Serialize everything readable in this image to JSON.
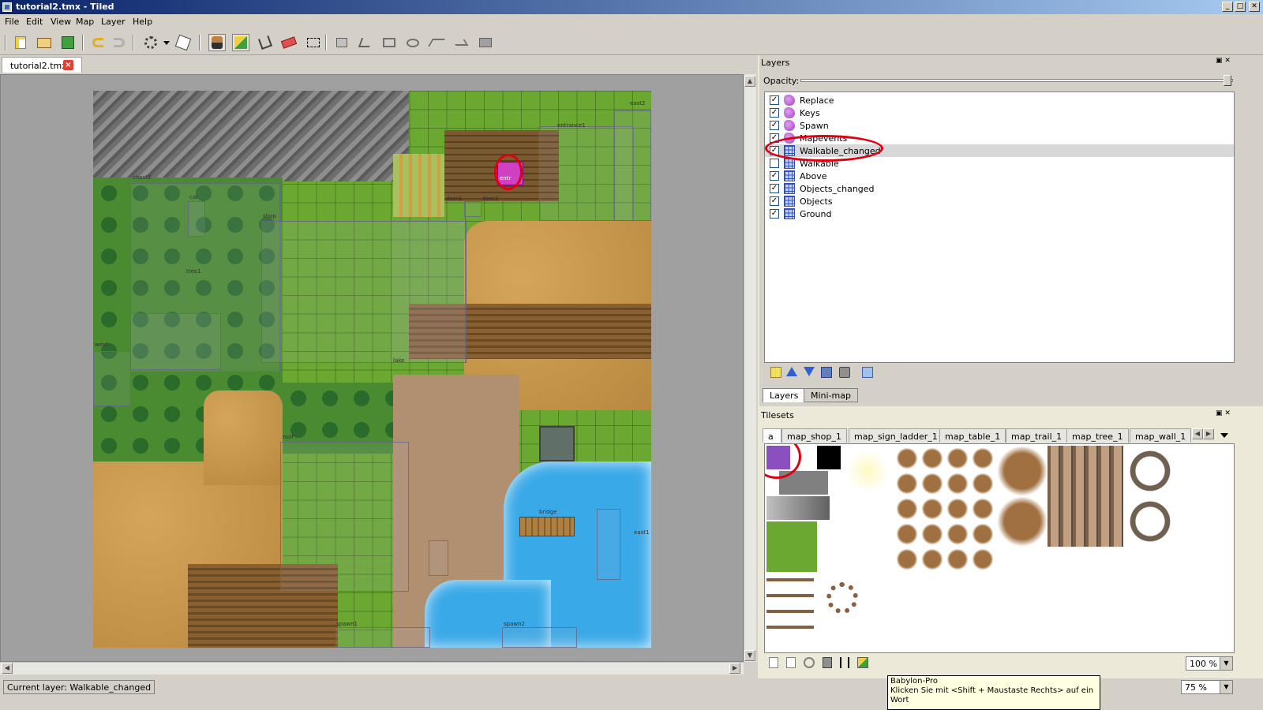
{
  "window": {
    "title": "tutorial2.tmx - Tiled",
    "minimize_glyph": "_",
    "maximize_glyph": "□",
    "close_glyph": "✕"
  },
  "menu": [
    "File",
    "Edit",
    "View",
    "Map",
    "Layer",
    "Help"
  ],
  "toolbar": {
    "icons": [
      "new-file-icon",
      "open-file-icon",
      "save-icon",
      "undo-icon",
      "redo-icon",
      "random-mode-icon",
      "dice-icon",
      "stamp-brush-icon",
      "terrain-brush-icon",
      "bucket-fill-icon",
      "eraser-icon",
      "rectangle-select-icon",
      "select-objects-icon",
      "edit-polygons-icon",
      "insert-rectangle-icon",
      "insert-ellipse-icon",
      "insert-polygon-icon",
      "insert-polyline-icon",
      "insert-tile-icon"
    ],
    "active": [
      "stamp-brush-icon",
      "terrain-brush-icon"
    ]
  },
  "document_tab": {
    "label": "tutorial2.tmx",
    "close_glyph": "×"
  },
  "map": {
    "object_labels": [
      "north",
      "east2",
      "entrance1",
      "chest2",
      "cat",
      "door1",
      "door2",
      "spawn1",
      "spawn2",
      "east1",
      "west",
      "tree1",
      "shop",
      "roof",
      "lake",
      "bridge"
    ],
    "highlighted_object_label": "entr"
  },
  "layers_panel": {
    "title": "Layers",
    "opacity_label": "Opacity:",
    "opacity": 1.0,
    "layers": [
      {
        "name": "Replace",
        "type": "object",
        "visible": true
      },
      {
        "name": "Keys",
        "type": "object",
        "visible": true
      },
      {
        "name": "Spawn",
        "type": "object",
        "visible": true
      },
      {
        "name": "Mapevents",
        "type": "object",
        "visible": true
      },
      {
        "name": "Walkable_changed",
        "type": "tile",
        "visible": true,
        "selected": true
      },
      {
        "name": "Walkable",
        "type": "tile",
        "visible": false
      },
      {
        "name": "Above",
        "type": "tile",
        "visible": true
      },
      {
        "name": "Objects_changed",
        "type": "tile",
        "visible": true
      },
      {
        "name": "Objects",
        "type": "tile",
        "visible": true
      },
      {
        "name": "Ground",
        "type": "tile",
        "visible": true
      }
    ],
    "tabs": [
      "Layers",
      "Mini-map"
    ],
    "active_tab": "Layers"
  },
  "tilesets_panel": {
    "title": "Tilesets",
    "tabs": [
      "a",
      "map_shop_1",
      "map_sign_ladder_1",
      "map_table_1",
      "map_trail_1",
      "map_tree_1",
      "map_wall_1"
    ],
    "active_tab": "a",
    "zoom": "100 %"
  },
  "statusbar": {
    "current_layer": "Current layer: Walkable_changed",
    "zoom": "75 %"
  },
  "tooltip": {
    "line1": "Babylon-Pro",
    "line2": "Klicken Sie mit <Shift + Maustaste Rechts> auf ein Wort"
  },
  "colors": {
    "selection_ring": "#e00010",
    "walkable_tile": "#8c4fc0",
    "title_gradient_start": "#0a246a"
  }
}
